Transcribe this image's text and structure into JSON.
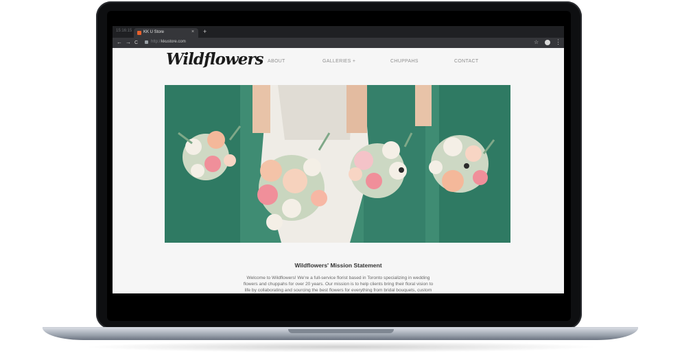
{
  "browser": {
    "clock": "15:16:15",
    "tab_title": "KK U Store",
    "tab_close": "×",
    "new_tab": "+",
    "back": "←",
    "forward": "→",
    "reload": "C",
    "url_scheme": "http://",
    "url_host": "kkustore.com",
    "star": "☆",
    "menu": "⋮"
  },
  "site": {
    "logo": "Wildflowers",
    "nav": [
      {
        "label": "ABOUT"
      },
      {
        "label": "GALLERIES  +"
      },
      {
        "label": "CHUPPAHS"
      },
      {
        "label": "CONTACT"
      }
    ],
    "hero_alt": "",
    "mission": {
      "title": "Wildflowers' Mission Statement",
      "lines": [
        "Welcome to Wildflowers! We're a full-service florist based in Toronto specializing in wedding",
        "flowers and chuppahs for over 20 years. Our mission is to help clients bring their floral vision to",
        "life by collaborating and sourcing the best flowers for everything from bridal bouquets, custom"
      ]
    }
  },
  "colors": {
    "dress": "#3d8a72",
    "peach": "#f4b89a",
    "pink": "#f08f9a",
    "cream": "#f4efe6"
  }
}
